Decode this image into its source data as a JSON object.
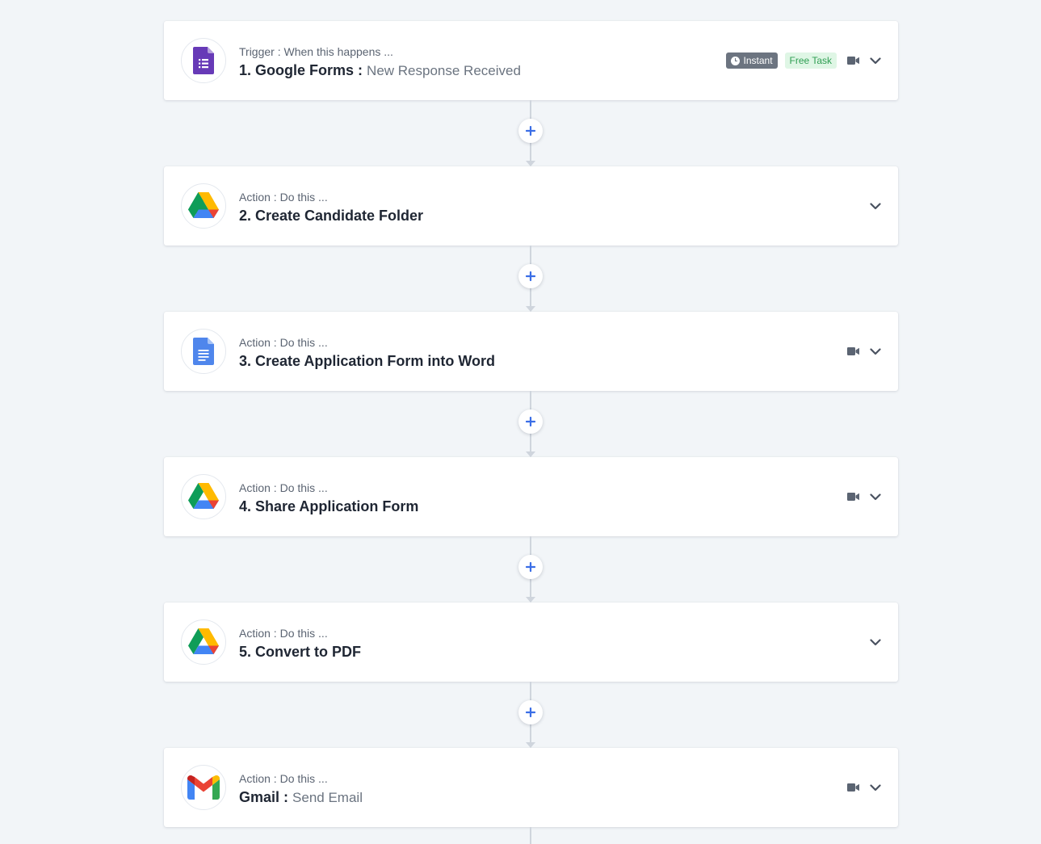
{
  "steps": [
    {
      "kind": "Trigger : When this happens ...",
      "title": "1. Google Forms :",
      "subtitle": "New Response Received",
      "icon": "google-forms-icon",
      "badges": {
        "instant": "Instant",
        "free": "Free Task"
      },
      "has_video": true
    },
    {
      "kind": "Action : Do this ...",
      "title": "2. Create Candidate Folder",
      "subtitle": "",
      "icon": "google-drive-icon",
      "has_video": false
    },
    {
      "kind": "Action : Do this ...",
      "title": "3. Create Application Form into Word",
      "subtitle": "",
      "icon": "google-docs-icon",
      "has_video": true
    },
    {
      "kind": "Action : Do this ...",
      "title": "4. Share Application Form",
      "subtitle": "",
      "icon": "google-drive-icon",
      "has_video": true
    },
    {
      "kind": "Action : Do this ...",
      "title": "5. Convert to PDF",
      "subtitle": "",
      "icon": "google-drive-icon",
      "has_video": false
    },
    {
      "kind": "Action : Do this ...",
      "title": "Gmail :",
      "subtitle": "Send Email",
      "icon": "gmail-icon",
      "has_video": true
    }
  ],
  "colors": {
    "background": "#f2f5f8",
    "add_button_plus": "#3b6ee6",
    "instant_badge": "#6c7480",
    "free_task_badge_bg": "#dff6e5",
    "free_task_badge_text": "#2f9e53"
  }
}
